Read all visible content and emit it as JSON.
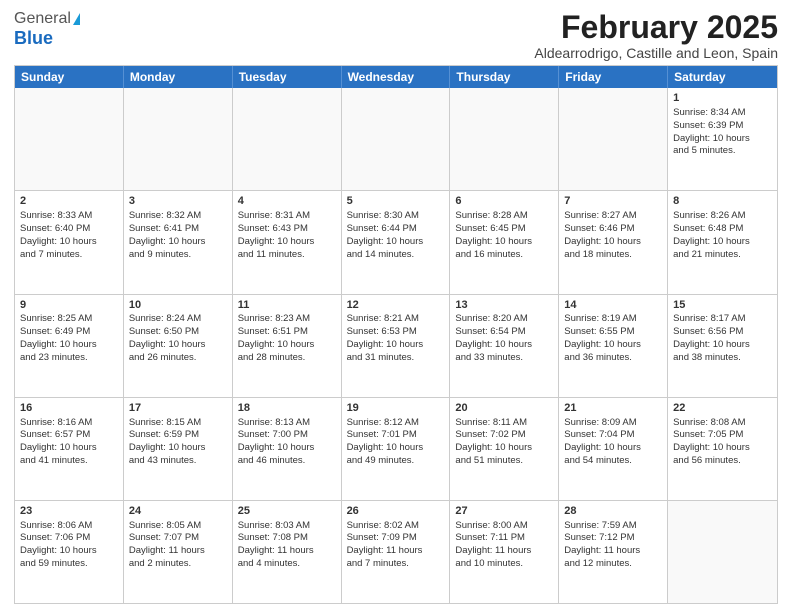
{
  "logo": {
    "general": "General",
    "blue": "Blue"
  },
  "title": "February 2025",
  "subtitle": "Aldearrodrigo, Castille and Leon, Spain",
  "header": {
    "days": [
      "Sunday",
      "Monday",
      "Tuesday",
      "Wednesday",
      "Thursday",
      "Friday",
      "Saturday"
    ]
  },
  "rows": [
    [
      {
        "day": "",
        "info": ""
      },
      {
        "day": "",
        "info": ""
      },
      {
        "day": "",
        "info": ""
      },
      {
        "day": "",
        "info": ""
      },
      {
        "day": "",
        "info": ""
      },
      {
        "day": "",
        "info": ""
      },
      {
        "day": "1",
        "info": "Sunrise: 8:34 AM\nSunset: 6:39 PM\nDaylight: 10 hours\nand 5 minutes."
      }
    ],
    [
      {
        "day": "2",
        "info": "Sunrise: 8:33 AM\nSunset: 6:40 PM\nDaylight: 10 hours\nand 7 minutes."
      },
      {
        "day": "3",
        "info": "Sunrise: 8:32 AM\nSunset: 6:41 PM\nDaylight: 10 hours\nand 9 minutes."
      },
      {
        "day": "4",
        "info": "Sunrise: 8:31 AM\nSunset: 6:43 PM\nDaylight: 10 hours\nand 11 minutes."
      },
      {
        "day": "5",
        "info": "Sunrise: 8:30 AM\nSunset: 6:44 PM\nDaylight: 10 hours\nand 14 minutes."
      },
      {
        "day": "6",
        "info": "Sunrise: 8:28 AM\nSunset: 6:45 PM\nDaylight: 10 hours\nand 16 minutes."
      },
      {
        "day": "7",
        "info": "Sunrise: 8:27 AM\nSunset: 6:46 PM\nDaylight: 10 hours\nand 18 minutes."
      },
      {
        "day": "8",
        "info": "Sunrise: 8:26 AM\nSunset: 6:48 PM\nDaylight: 10 hours\nand 21 minutes."
      }
    ],
    [
      {
        "day": "9",
        "info": "Sunrise: 8:25 AM\nSunset: 6:49 PM\nDaylight: 10 hours\nand 23 minutes."
      },
      {
        "day": "10",
        "info": "Sunrise: 8:24 AM\nSunset: 6:50 PM\nDaylight: 10 hours\nand 26 minutes."
      },
      {
        "day": "11",
        "info": "Sunrise: 8:23 AM\nSunset: 6:51 PM\nDaylight: 10 hours\nand 28 minutes."
      },
      {
        "day": "12",
        "info": "Sunrise: 8:21 AM\nSunset: 6:53 PM\nDaylight: 10 hours\nand 31 minutes."
      },
      {
        "day": "13",
        "info": "Sunrise: 8:20 AM\nSunset: 6:54 PM\nDaylight: 10 hours\nand 33 minutes."
      },
      {
        "day": "14",
        "info": "Sunrise: 8:19 AM\nSunset: 6:55 PM\nDaylight: 10 hours\nand 36 minutes."
      },
      {
        "day": "15",
        "info": "Sunrise: 8:17 AM\nSunset: 6:56 PM\nDaylight: 10 hours\nand 38 minutes."
      }
    ],
    [
      {
        "day": "16",
        "info": "Sunrise: 8:16 AM\nSunset: 6:57 PM\nDaylight: 10 hours\nand 41 minutes."
      },
      {
        "day": "17",
        "info": "Sunrise: 8:15 AM\nSunset: 6:59 PM\nDaylight: 10 hours\nand 43 minutes."
      },
      {
        "day": "18",
        "info": "Sunrise: 8:13 AM\nSunset: 7:00 PM\nDaylight: 10 hours\nand 46 minutes."
      },
      {
        "day": "19",
        "info": "Sunrise: 8:12 AM\nSunset: 7:01 PM\nDaylight: 10 hours\nand 49 minutes."
      },
      {
        "day": "20",
        "info": "Sunrise: 8:11 AM\nSunset: 7:02 PM\nDaylight: 10 hours\nand 51 minutes."
      },
      {
        "day": "21",
        "info": "Sunrise: 8:09 AM\nSunset: 7:04 PM\nDaylight: 10 hours\nand 54 minutes."
      },
      {
        "day": "22",
        "info": "Sunrise: 8:08 AM\nSunset: 7:05 PM\nDaylight: 10 hours\nand 56 minutes."
      }
    ],
    [
      {
        "day": "23",
        "info": "Sunrise: 8:06 AM\nSunset: 7:06 PM\nDaylight: 10 hours\nand 59 minutes."
      },
      {
        "day": "24",
        "info": "Sunrise: 8:05 AM\nSunset: 7:07 PM\nDaylight: 11 hours\nand 2 minutes."
      },
      {
        "day": "25",
        "info": "Sunrise: 8:03 AM\nSunset: 7:08 PM\nDaylight: 11 hours\nand 4 minutes."
      },
      {
        "day": "26",
        "info": "Sunrise: 8:02 AM\nSunset: 7:09 PM\nDaylight: 11 hours\nand 7 minutes."
      },
      {
        "day": "27",
        "info": "Sunrise: 8:00 AM\nSunset: 7:11 PM\nDaylight: 11 hours\nand 10 minutes."
      },
      {
        "day": "28",
        "info": "Sunrise: 7:59 AM\nSunset: 7:12 PM\nDaylight: 11 hours\nand 12 minutes."
      },
      {
        "day": "",
        "info": ""
      }
    ]
  ]
}
